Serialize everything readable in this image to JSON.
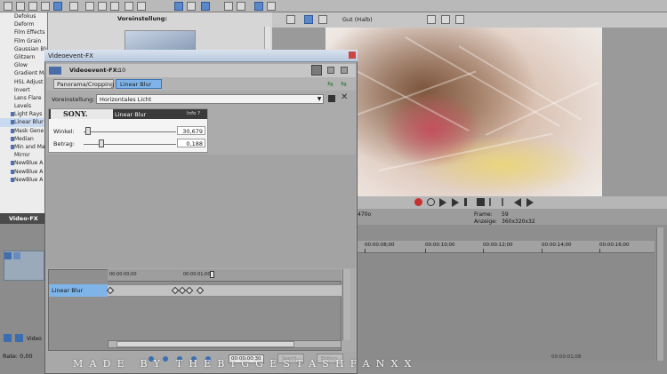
{
  "fx_list": {
    "items": [
      "Defokus",
      "Deform",
      "Film Effects",
      "Film Grain",
      "Gaussian Blur",
      "Glitzern",
      "Glow",
      "Gradient Map",
      "HSL Adjust",
      "Invert",
      "Lens Flare",
      "Levels",
      "Light Rays",
      "Linear Blur",
      "Mask Gene",
      "Median",
      "Min and Max",
      "Mirror",
      "NewBlue A",
      "NewBlue A",
      "NewBlue A"
    ],
    "selected_index": 13,
    "plugin_marked": [
      12,
      13,
      14,
      15,
      16,
      18,
      19,
      20
    ]
  },
  "preset_pane": {
    "label": "Voreinstellung:"
  },
  "video_fx_tab": "Video-FX",
  "preview": {
    "quality": "Gut (Halb)"
  },
  "info_bar": {
    "frame_label": "Frame:",
    "frame_value": "59",
    "display_label": "Anzeige:",
    "display_value": "360x320x32",
    "left_value": "470o"
  },
  "timeline": {
    "ticks": [
      "00:00:08;00",
      "00:00:10;00",
      "00:00:12;00",
      "00:00:14;00",
      "00:00:16;00"
    ]
  },
  "mini_track": {
    "video_label": "Video"
  },
  "rate": "Rate: 0,00",
  "dialog": {
    "title": "Videoevent-FX",
    "header_title": "Videoevent-FX:",
    "header_count": "10",
    "chain": {
      "pan_label": "Panorama/Cropping",
      "blur_label": "Linear Blur"
    },
    "preset_label": "Voreinstellung:",
    "preset_value": "Horizontales Licht",
    "plugin": {
      "brand": "SONY.",
      "name": "Linear Blur",
      "info": "Info  ?"
    },
    "params": [
      {
        "label": "Winkel:",
        "value": "30,679",
        "level": 0.05
      },
      {
        "label": "Betrag:",
        "value": "0,188",
        "level": 0.19
      }
    ],
    "kf_times": [
      "00:00:00;00",
      "00:00:01;00"
    ],
    "kf_track_label": "Linear Blur",
    "timecode": "00:00:00;30",
    "btn_a": "Speich.",
    "btn_b": "Entfern."
  },
  "watermark": "MADE BY THEBIGGESTASHFANXX",
  "bottom_timecode": "00:00:01;08",
  "colors": {
    "selection_blue": "#7fb4e8",
    "dialog_gray": "#ababab",
    "toolbar_gray": "#b9b9b9"
  }
}
